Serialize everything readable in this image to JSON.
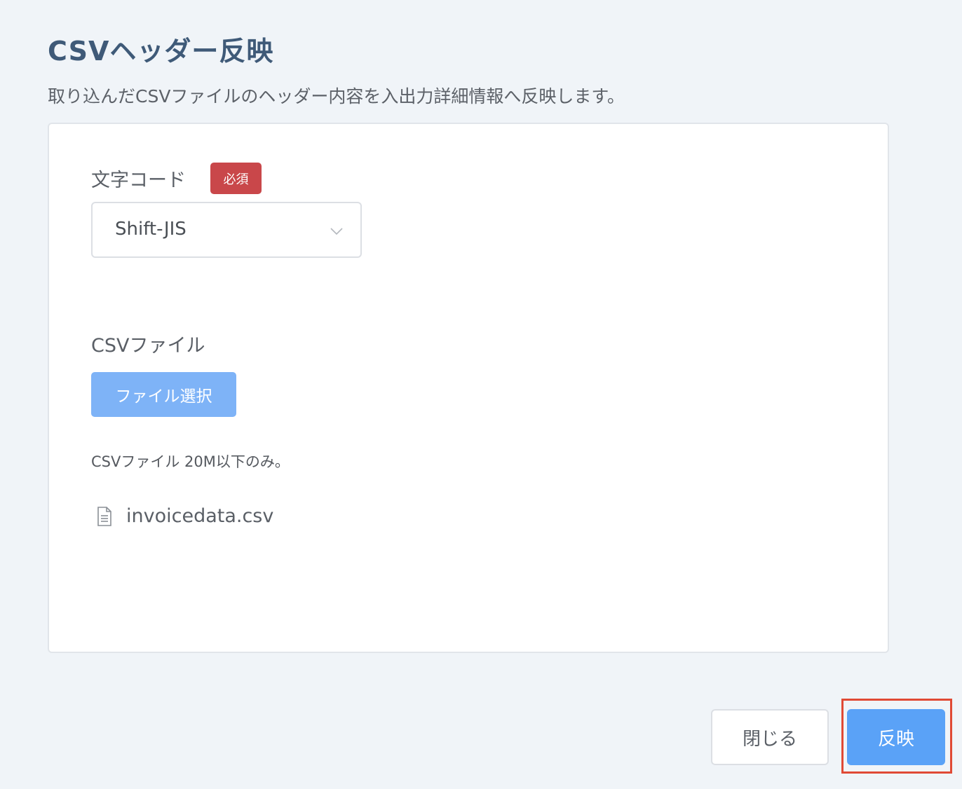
{
  "header": {
    "title": "CSVヘッダー反映",
    "description": "取り込んだCSVファイルのヘッダー内容を入出力詳細情報へ反映します。"
  },
  "form": {
    "encoding": {
      "label": "文字コード",
      "required_badge": "必須",
      "selected_value": "Shift-JIS",
      "icon": "chevron-down-icon"
    },
    "csv_file": {
      "label": "CSVファイル",
      "button_label": "ファイル選択",
      "hint": "CSVファイル 20M以下のみ。",
      "file_icon": "document-icon",
      "file_name": "invoicedata.csv"
    }
  },
  "footer": {
    "close_label": "閉じる",
    "apply_label": "反映"
  },
  "colors": {
    "title": "#3f5a78",
    "required_badge": "#c9474a",
    "file_button": "#7eb3f7",
    "apply_button": "#5aa2f7",
    "highlight": "#e04a35",
    "background": "#f0f4f8"
  }
}
